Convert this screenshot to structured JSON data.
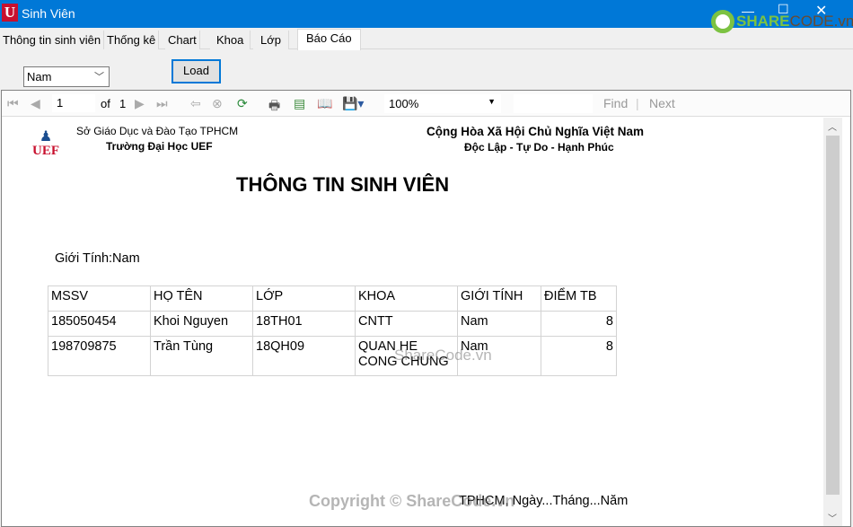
{
  "window": {
    "title": "Sinh Viên",
    "icon": "U"
  },
  "watermark": {
    "logo": "SHARECODE.vn",
    "center": "ShareCode.vn",
    "footer": "Copyright © ShareCode.vn"
  },
  "tabs": [
    {
      "label": "Thông tin sinh viên"
    },
    {
      "label": "Thống kê"
    },
    {
      "label": "Chart"
    },
    {
      "label": "Khoa"
    },
    {
      "label": "Lớp"
    },
    {
      "label": "Báo Cáo",
      "active": true
    }
  ],
  "filter": {
    "gender_selected": "Nam",
    "load_label": "Load"
  },
  "toolbar": {
    "page": "1",
    "of_label": "of",
    "total_pages": "1",
    "zoom": "100%",
    "find_label": "Find",
    "next_label": "Next"
  },
  "report": {
    "logo_text": "UEF",
    "org_line1": "Sở Giáo Dục và Đào Tạo TPHCM",
    "org_line2": "Trường Đại Học UEF",
    "nation_line1": "Cộng Hòa Xã Hội Chủ Nghĩa Việt Nam",
    "nation_line2": "Độc Lập - Tự Do - Hạnh Phúc",
    "title": "THÔNG TIN SINH VIÊN",
    "gender_label": "Giới Tính:Nam",
    "columns": [
      "MSSV",
      "HỌ TÊN",
      "LỚP",
      "KHOA",
      "GIỚI TÍNH",
      "ĐIỂM TB"
    ],
    "rows": [
      [
        "185050454",
        "Khoi Nguyen",
        "18TH01",
        "CNTT",
        "Nam",
        "8"
      ],
      [
        "198709875",
        "Trần Tùng",
        "18QH09",
        "QUAN HE CONG CHUNG",
        "Nam",
        "8"
      ]
    ],
    "footer_date": "TPHCM, Ngày...Tháng...Năm"
  }
}
